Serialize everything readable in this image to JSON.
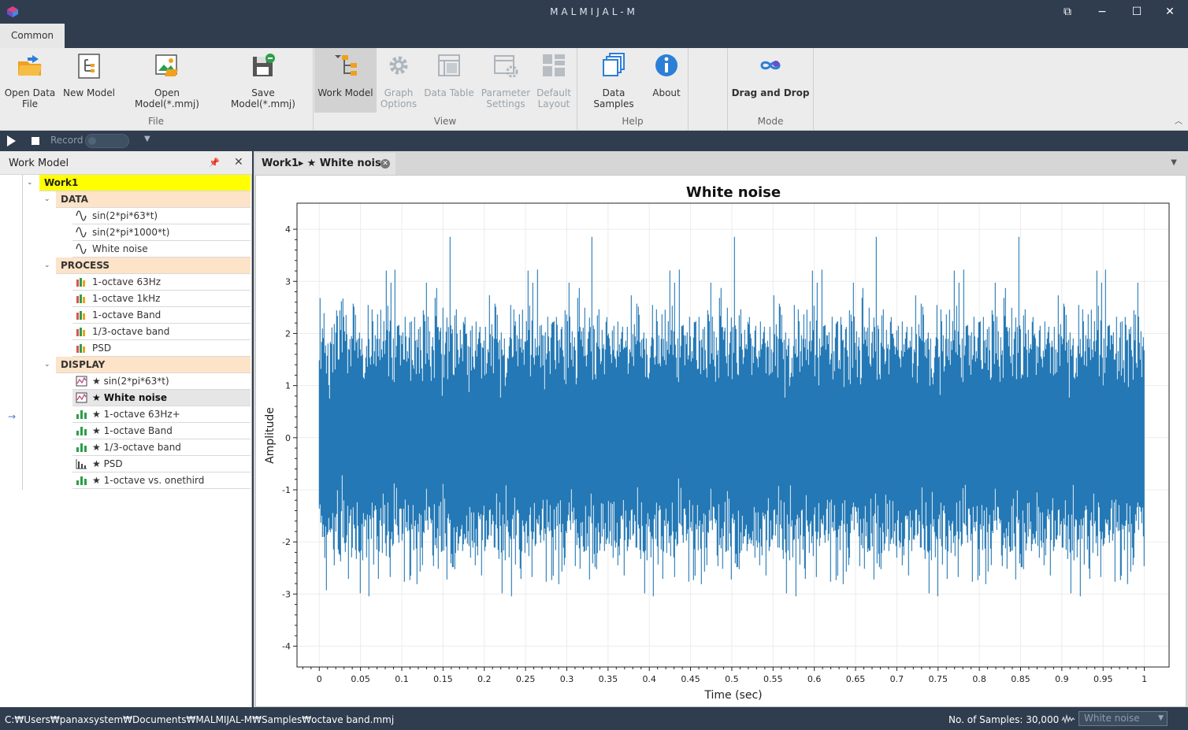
{
  "window": {
    "title": "MALMIJAL-M"
  },
  "ribbon": {
    "tab": "Common",
    "groups": {
      "file": "File",
      "view": "View",
      "help": "Help",
      "mode": "Mode"
    },
    "buttons": {
      "open_data_file": "Open Data\nFile",
      "new_model": "New Model",
      "open_model": "Open Model(*.mmj)",
      "save_model": "Save Model(*.mmj)",
      "work_model": "Work Model",
      "graph_options": "Graph\nOptions",
      "data_table": "Data Table",
      "parameter_settings": "Parameter\nSettings",
      "default_layout": "Default\nLayout",
      "data_samples": "Data Samples",
      "about": "About",
      "drag_and_drop": "Drag and Drop"
    }
  },
  "playbar": {
    "record_label": "Record"
  },
  "work_model": {
    "title": "Work Model",
    "root": "Work1",
    "categories": {
      "data": {
        "label": "DATA",
        "items": [
          "sin(2*pi*63*t)",
          "sin(2*pi*1000*t)",
          "White noise"
        ]
      },
      "process": {
        "label": "PROCESS",
        "items": [
          "1-octave 63Hz",
          "1-octave 1kHz",
          "1-octave Band",
          "1/3-octave band",
          "PSD"
        ]
      },
      "display": {
        "label": "DISPLAY",
        "items": [
          "★ sin(2*pi*63*t)",
          "★ White noise",
          "★ 1-octave 63Hz+",
          "★ 1-octave Band",
          "★ 1/3-octave band",
          "★ PSD",
          "★ 1-octave vs. onethird"
        ],
        "selected": "★ White noise"
      }
    }
  },
  "document": {
    "tab_prefix": "Work1▸",
    "tab_title": "★ White noise"
  },
  "chart_data": {
    "type": "line",
    "title": "White noise",
    "xlabel": "Time (sec)",
    "ylabel": "Amplitude",
    "xlim": [
      -0.027,
      1.03
    ],
    "ylim": [
      -4.4,
      4.5
    ],
    "x_ticks": [
      0,
      0.05,
      0.1,
      0.15,
      0.2,
      0.25,
      0.3,
      0.35,
      0.4,
      0.45,
      0.5,
      0.55,
      0.6,
      0.65,
      0.7,
      0.75,
      0.8,
      0.85,
      0.9,
      0.95,
      1
    ],
    "y_ticks": [
      -4,
      -3,
      -2,
      -1,
      0,
      1,
      2,
      3,
      4
    ],
    "grid": true,
    "series": [
      {
        "color": "#2378b5",
        "samples": 30000,
        "x_range": [
          0,
          1
        ],
        "y_min": -4.1,
        "y_max": 4.2
      }
    ]
  },
  "status": {
    "path": "C:₩Users₩panaxsystem₩Documents₩MALMIJAL-M₩Samples₩octave band.mmj",
    "samples": "No. of Samples: 30,000",
    "selected_display": "White noise"
  }
}
